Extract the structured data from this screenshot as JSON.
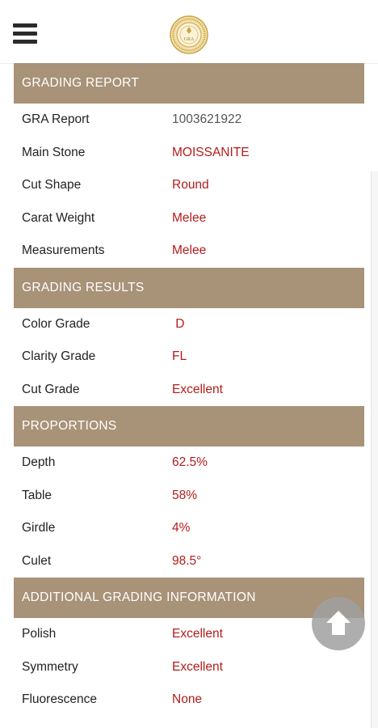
{
  "header": {
    "menu_icon": "hamburger-menu-icon",
    "logo_icon": "gra-seal-logo-icon",
    "logo_text": "GRA"
  },
  "sections": {
    "grading_report": {
      "title": "GRADING REPORT",
      "rows": [
        {
          "label": "GRA Report",
          "value": "1003621922"
        },
        {
          "label": "Main Stone",
          "value": "MOISSANITE"
        },
        {
          "label": "Cut Shape",
          "value": "Round"
        },
        {
          "label": "Carat Weight",
          "value": "Melee"
        },
        {
          "label": "Measurements",
          "value": "Melee"
        }
      ]
    },
    "grading_results": {
      "title": "GRADING RESULTS",
      "rows": [
        {
          "label": "Color Grade",
          "value": " D"
        },
        {
          "label": "Clarity Grade",
          "value": "FL"
        },
        {
          "label": "Cut Grade",
          "value": "Excellent"
        }
      ]
    },
    "proportions": {
      "title": "PROPORTIONS",
      "rows": [
        {
          "label": "Depth",
          "value": "62.5%"
        },
        {
          "label": "Table",
          "value": "58%"
        },
        {
          "label": "Girdle",
          "value": "4%"
        },
        {
          "label": "Culet",
          "value": "98.5°"
        }
      ]
    },
    "additional": {
      "title": "ADDITIONAL GRADING INFORMATION",
      "rows": [
        {
          "label": "Polish",
          "value": "Excellent"
        },
        {
          "label": "Symmetry",
          "value": "Excellent"
        },
        {
          "label": "Fluorescence",
          "value": "None"
        }
      ]
    }
  },
  "scroll_top_icon": "arrow-up-icon",
  "colors": {
    "section_header_bg": "#a89278",
    "value_red": "#b31b1b",
    "logo_gold": "#c9a448"
  }
}
